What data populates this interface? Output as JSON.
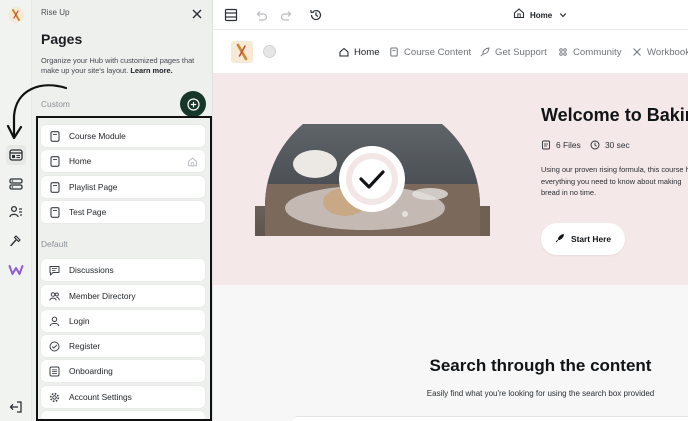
{
  "app": {
    "name": "Rise Up"
  },
  "panel": {
    "title": "Pages",
    "description": "Organize your Hub with customized pages that make up your site's layout.",
    "learn_more": "Learn more.",
    "custom_label": "Custom",
    "default_label": "Default",
    "custom_pages": [
      {
        "label": "Course Module",
        "icon": "page-icon"
      },
      {
        "label": "Home",
        "icon": "page-icon",
        "home_badge": "home-icon"
      },
      {
        "label": "Playlist Page",
        "icon": "page-icon"
      },
      {
        "label": "Test Page",
        "icon": "page-icon"
      }
    ],
    "default_pages": [
      {
        "label": "Discussions",
        "icon": "chat-icon"
      },
      {
        "label": "Member Directory",
        "icon": "members-icon"
      },
      {
        "label": "Login",
        "icon": "user-icon"
      },
      {
        "label": "Register",
        "icon": "check-circle-icon"
      },
      {
        "label": "Onboarding",
        "icon": "checklist-icon"
      },
      {
        "label": "Account Settings",
        "icon": "gear-icon"
      }
    ]
  },
  "toolbar": {
    "page_selector": "Home"
  },
  "site": {
    "nav": [
      {
        "label": "Home",
        "icon": "home-icon",
        "active": true
      },
      {
        "label": "Course Content",
        "icon": "book-icon",
        "active": false
      },
      {
        "label": "Get Support",
        "icon": "rocket-icon",
        "active": false
      },
      {
        "label": "Community",
        "icon": "community-icon",
        "active": false
      },
      {
        "label": "Workbook",
        "icon": "tools-icon",
        "active": false
      }
    ],
    "hero": {
      "title": "Welcome to Baking",
      "files": "6 Files",
      "duration": "30 sec",
      "description": "Using our proven rising formula, this course has everything you need to know about making bread in no time.",
      "cta": "Start Here"
    },
    "search": {
      "title": "Search through the content",
      "subtitle": "Easily find what you're looking for using the search box provided"
    }
  },
  "colors": {
    "add_button": "#17372b",
    "hero_background": "#f5e8e8",
    "panel_background": "#eef0ee",
    "brand_logo_purple": "#8f5bd6"
  }
}
